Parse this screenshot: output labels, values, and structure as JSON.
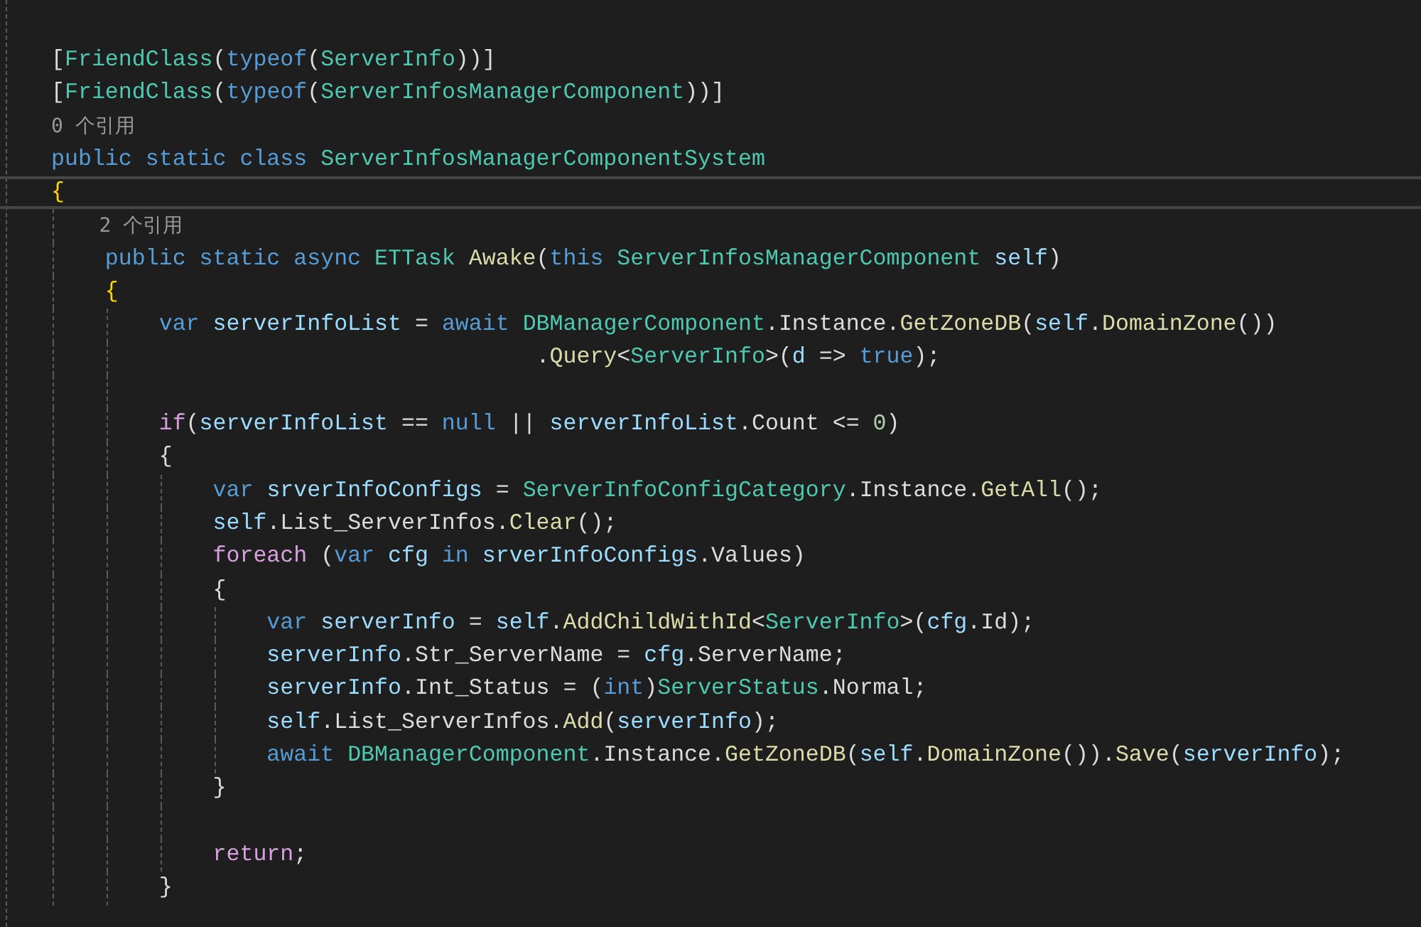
{
  "editor": {
    "lines": [
      {
        "kind": "code",
        "current": false,
        "tokens": [
          {
            "kind": "plain",
            "text": "["
          },
          {
            "kind": "type",
            "text": "FriendClass"
          },
          {
            "kind": "plain",
            "text": "("
          },
          {
            "kind": "keyword",
            "text": "typeof"
          },
          {
            "kind": "plain",
            "text": "("
          },
          {
            "kind": "type",
            "text": "ServerInfo"
          },
          {
            "kind": "plain",
            "text": "))]"
          }
        ]
      },
      {
        "kind": "code",
        "current": false,
        "tokens": [
          {
            "kind": "plain",
            "text": "["
          },
          {
            "kind": "type",
            "text": "FriendClass"
          },
          {
            "kind": "plain",
            "text": "("
          },
          {
            "kind": "keyword",
            "text": "typeof"
          },
          {
            "kind": "plain",
            "text": "("
          },
          {
            "kind": "type",
            "text": "ServerInfosManagerComponent"
          },
          {
            "kind": "plain",
            "text": "))]"
          }
        ]
      },
      {
        "kind": "lens",
        "text": "0 个引用"
      },
      {
        "kind": "code",
        "current": false,
        "tokens": [
          {
            "kind": "keyword",
            "text": "public static class "
          },
          {
            "kind": "type",
            "text": "ServerInfosManagerComponentSystem"
          }
        ]
      },
      {
        "kind": "code",
        "current": true,
        "tokens": [
          {
            "kind": "brace",
            "text": "{"
          }
        ]
      },
      {
        "kind": "lens",
        "text": "    2 个引用"
      },
      {
        "kind": "code",
        "current": false,
        "tokens": [
          {
            "kind": "keyword",
            "text": "    public static async "
          },
          {
            "kind": "type",
            "text": "ETTask "
          },
          {
            "kind": "method",
            "text": "Awake"
          },
          {
            "kind": "plain",
            "text": "("
          },
          {
            "kind": "keyword",
            "text": "this "
          },
          {
            "kind": "type",
            "text": "ServerInfosManagerComponent "
          },
          {
            "kind": "variable",
            "text": "self"
          },
          {
            "kind": "plain",
            "text": ")"
          }
        ]
      },
      {
        "kind": "code",
        "current": false,
        "tokens": [
          {
            "kind": "brace",
            "text": "    {"
          }
        ]
      },
      {
        "kind": "code",
        "current": false,
        "tokens": [
          {
            "kind": "keyword",
            "text": "        var "
          },
          {
            "kind": "variable",
            "text": "serverInfoList"
          },
          {
            "kind": "plain",
            "text": " = "
          },
          {
            "kind": "keyword",
            "text": "await "
          },
          {
            "kind": "type",
            "text": "DBManagerComponent"
          },
          {
            "kind": "plain",
            "text": ".Instance."
          },
          {
            "kind": "method",
            "text": "GetZoneDB"
          },
          {
            "kind": "plain",
            "text": "("
          },
          {
            "kind": "variable",
            "text": "self"
          },
          {
            "kind": "plain",
            "text": "."
          },
          {
            "kind": "method",
            "text": "DomainZone"
          },
          {
            "kind": "plain",
            "text": "())"
          }
        ]
      },
      {
        "kind": "wrap",
        "current": false,
        "tokens": [
          {
            "kind": "plain",
            "text": "                                    ."
          },
          {
            "kind": "method",
            "text": "Query"
          },
          {
            "kind": "plain",
            "text": "<"
          },
          {
            "kind": "type",
            "text": "ServerInfo"
          },
          {
            "kind": "plain",
            "text": ">("
          },
          {
            "kind": "variable",
            "text": "d"
          },
          {
            "kind": "plain",
            "text": " => "
          },
          {
            "kind": "keyword",
            "text": "true"
          },
          {
            "kind": "plain",
            "text": ");"
          }
        ]
      },
      {
        "kind": "blank"
      },
      {
        "kind": "code",
        "current": false,
        "tokens": [
          {
            "kind": "control",
            "text": "        if"
          },
          {
            "kind": "plain",
            "text": "("
          },
          {
            "kind": "variable",
            "text": "serverInfoList"
          },
          {
            "kind": "plain",
            "text": " == "
          },
          {
            "kind": "keyword",
            "text": "null"
          },
          {
            "kind": "plain",
            "text": " || "
          },
          {
            "kind": "variable",
            "text": "serverInfoList"
          },
          {
            "kind": "plain",
            "text": ".Count <= "
          },
          {
            "kind": "number",
            "text": "0"
          },
          {
            "kind": "plain",
            "text": ")"
          }
        ]
      },
      {
        "kind": "code",
        "current": false,
        "tokens": [
          {
            "kind": "plain",
            "text": "        {"
          }
        ]
      },
      {
        "kind": "code",
        "current": false,
        "tokens": [
          {
            "kind": "keyword",
            "text": "            var "
          },
          {
            "kind": "variable",
            "text": "srverInfoConfigs"
          },
          {
            "kind": "plain",
            "text": " = "
          },
          {
            "kind": "type",
            "text": "ServerInfoConfigCategory"
          },
          {
            "kind": "plain",
            "text": ".Instance."
          },
          {
            "kind": "method",
            "text": "GetAll"
          },
          {
            "kind": "plain",
            "text": "();"
          }
        ]
      },
      {
        "kind": "code",
        "current": false,
        "tokens": [
          {
            "kind": "variable",
            "text": "            self"
          },
          {
            "kind": "plain",
            "text": ".List_ServerInfos."
          },
          {
            "kind": "method",
            "text": "Clear"
          },
          {
            "kind": "plain",
            "text": "();"
          }
        ]
      },
      {
        "kind": "code",
        "current": false,
        "tokens": [
          {
            "kind": "control",
            "text": "            foreach"
          },
          {
            "kind": "plain",
            "text": " ("
          },
          {
            "kind": "keyword",
            "text": "var "
          },
          {
            "kind": "variable",
            "text": "cfg "
          },
          {
            "kind": "keyword",
            "text": "in "
          },
          {
            "kind": "variable",
            "text": "srverInfoConfigs"
          },
          {
            "kind": "plain",
            "text": ".Values)"
          }
        ]
      },
      {
        "kind": "code",
        "current": false,
        "tokens": [
          {
            "kind": "plain",
            "text": "            {"
          }
        ]
      },
      {
        "kind": "code",
        "current": false,
        "tokens": [
          {
            "kind": "keyword",
            "text": "                var "
          },
          {
            "kind": "variable",
            "text": "serverInfo"
          },
          {
            "kind": "plain",
            "text": " = "
          },
          {
            "kind": "variable",
            "text": "self"
          },
          {
            "kind": "plain",
            "text": "."
          },
          {
            "kind": "method",
            "text": "AddChildWithId"
          },
          {
            "kind": "plain",
            "text": "<"
          },
          {
            "kind": "type",
            "text": "ServerInfo"
          },
          {
            "kind": "plain",
            "text": ">("
          },
          {
            "kind": "variable",
            "text": "cfg"
          },
          {
            "kind": "plain",
            "text": ".Id);"
          }
        ]
      },
      {
        "kind": "code",
        "current": false,
        "tokens": [
          {
            "kind": "variable",
            "text": "                serverInfo"
          },
          {
            "kind": "plain",
            "text": ".Str_ServerName = "
          },
          {
            "kind": "variable",
            "text": "cfg"
          },
          {
            "kind": "plain",
            "text": ".ServerName;"
          }
        ]
      },
      {
        "kind": "code",
        "current": false,
        "tokens": [
          {
            "kind": "variable",
            "text": "                serverInfo"
          },
          {
            "kind": "plain",
            "text": ".Int_Status = ("
          },
          {
            "kind": "keyword",
            "text": "int"
          },
          {
            "kind": "plain",
            "text": ")"
          },
          {
            "kind": "type",
            "text": "ServerStatus"
          },
          {
            "kind": "plain",
            "text": ".Normal;"
          }
        ]
      },
      {
        "kind": "code",
        "current": false,
        "tokens": [
          {
            "kind": "variable",
            "text": "                self"
          },
          {
            "kind": "plain",
            "text": ".List_ServerInfos."
          },
          {
            "kind": "method",
            "text": "Add"
          },
          {
            "kind": "plain",
            "text": "("
          },
          {
            "kind": "variable",
            "text": "serverInfo"
          },
          {
            "kind": "plain",
            "text": ");"
          }
        ]
      },
      {
        "kind": "code",
        "current": false,
        "tokens": [
          {
            "kind": "keyword",
            "text": "                await "
          },
          {
            "kind": "type",
            "text": "DBManagerComponent"
          },
          {
            "kind": "plain",
            "text": ".Instance."
          },
          {
            "kind": "method",
            "text": "GetZoneDB"
          },
          {
            "kind": "plain",
            "text": "("
          },
          {
            "kind": "variable",
            "text": "self"
          },
          {
            "kind": "plain",
            "text": "."
          },
          {
            "kind": "method",
            "text": "DomainZone"
          },
          {
            "kind": "plain",
            "text": "())."
          },
          {
            "kind": "method",
            "text": "Save"
          },
          {
            "kind": "plain",
            "text": "("
          },
          {
            "kind": "variable",
            "text": "serverInfo"
          },
          {
            "kind": "plain",
            "text": ");"
          }
        ]
      },
      {
        "kind": "code",
        "current": false,
        "tokens": [
          {
            "kind": "plain",
            "text": "            }"
          }
        ]
      },
      {
        "kind": "blank"
      },
      {
        "kind": "code",
        "current": false,
        "tokens": [
          {
            "kind": "control",
            "text": "            return"
          },
          {
            "kind": "plain",
            "text": ";"
          }
        ]
      },
      {
        "kind": "code",
        "current": false,
        "tokens": [
          {
            "kind": "plain",
            "text": "        }"
          }
        ]
      }
    ]
  }
}
